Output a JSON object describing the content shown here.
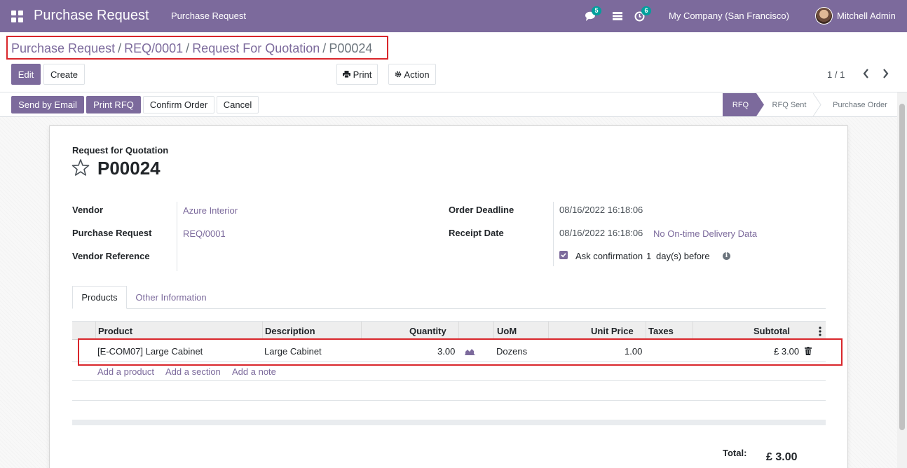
{
  "navbar": {
    "app_name": "Purchase Request",
    "menu_item": "Purchase Request",
    "messages_count": "5",
    "activities_count": "6",
    "company": "My Company (San Francisco)",
    "user": "Mitchell Admin"
  },
  "breadcrumb": {
    "items": [
      "Purchase Request",
      "REQ/0001",
      "Request For Quotation"
    ],
    "current": "P00024"
  },
  "toolbar": {
    "edit_label": "Edit",
    "create_label": "Create",
    "print_label": "Print",
    "action_label": "Action",
    "pager": "1 / 1"
  },
  "statusbar": {
    "send_email_label": "Send by Email",
    "print_rfq_label": "Print RFQ",
    "confirm_label": "Confirm Order",
    "cancel_label": "Cancel",
    "stages": [
      "RFQ",
      "RFQ Sent",
      "Purchase Order"
    ],
    "active_stage": "RFQ"
  },
  "form": {
    "subtitle": "Request for Quotation",
    "name": "P00024",
    "vendor_label": "Vendor",
    "vendor": "Azure Interior",
    "purchase_request_label": "Purchase Request",
    "purchase_request": "REQ/0001",
    "vendor_reference_label": "Vendor Reference",
    "vendor_reference": "",
    "order_deadline_label": "Order Deadline",
    "order_deadline": "08/16/2022 16:18:06",
    "receipt_date_label": "Receipt Date",
    "receipt_date": "08/16/2022 16:18:06",
    "on_time_delivery": "No On-time Delivery Data",
    "ask_confirmation_label": "Ask confirmation",
    "ask_confirmation_days": "1",
    "ask_confirmation_suffix": "day(s) before",
    "ask_confirmation_checked": true
  },
  "tabs": {
    "products": "Products",
    "other": "Other Information"
  },
  "order_lines": {
    "headers": {
      "product": "Product",
      "description": "Description",
      "quantity": "Quantity",
      "uom": "UoM",
      "unit_price": "Unit Price",
      "taxes": "Taxes",
      "subtotal": "Subtotal"
    },
    "rows": [
      {
        "product": "[E-COM07] Large Cabinet",
        "description": "Large Cabinet",
        "quantity": "3.00",
        "uom": "Dozens",
        "unit_price": "1.00",
        "taxes": "",
        "subtotal": "£ 3.00"
      }
    ],
    "add_product": "Add a product",
    "add_section": "Add a section",
    "add_note": "Add a note"
  },
  "totals": {
    "label": "Total:",
    "value": "£ 3.00"
  },
  "colors": {
    "brand": "#7c6a9c",
    "highlight": "#d9262b",
    "badge": "#00a09d"
  }
}
